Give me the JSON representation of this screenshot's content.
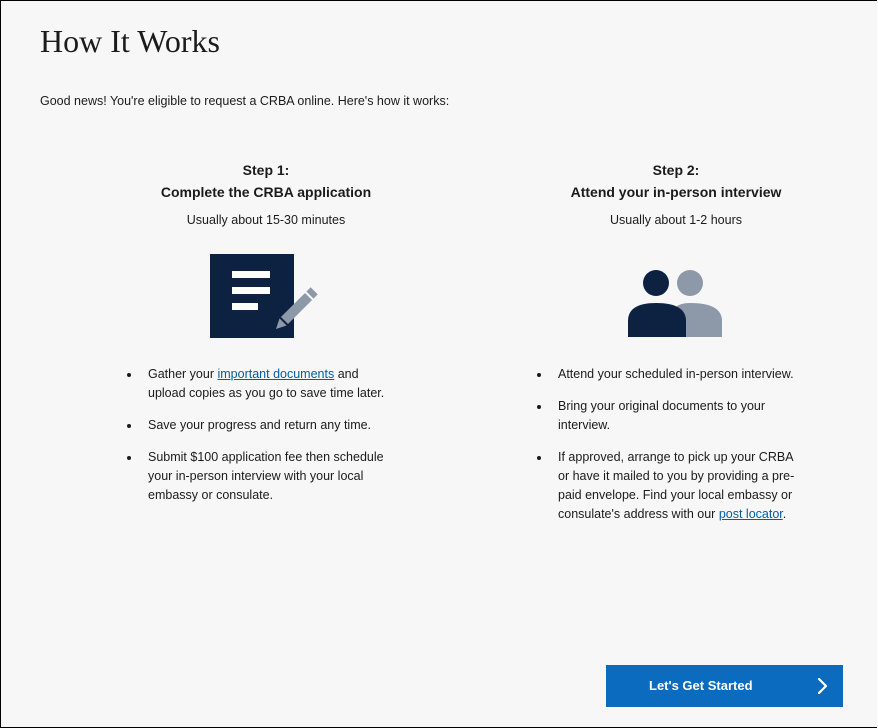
{
  "page": {
    "title": "How It Works",
    "intro": "Good news!  You're eligible to request a CRBA online.  Here's how it works:"
  },
  "step1": {
    "heading_line1": "Step 1:",
    "heading_line2": "Complete the CRBA application",
    "time": "Usually about 15-30 minutes",
    "icon": "document-pencil-icon",
    "bullets": {
      "b1_before": "Gather your ",
      "b1_link": "important documents",
      "b1_after": " and upload copies as you go to save time later.",
      "b2": "Save your progress and return any time.",
      "b3": "Submit $100 application fee then schedule your in-person interview with your local embassy or consulate."
    }
  },
  "step2": {
    "heading_line1": "Step 2:",
    "heading_line2": "Attend your in-person interview",
    "time": "Usually about 1-2 hours",
    "icon": "people-icon",
    "bullets": {
      "b1": "Attend your scheduled in-person interview.",
      "b2": "Bring your original documents to your interview.",
      "b3_before": "If approved, arrange to pick up your CRBA or have it mailed to you by providing a pre-paid envelope. Find your local embassy or consulate's address with our ",
      "b3_link": "post locator",
      "b3_after": "."
    }
  },
  "cta": {
    "label": "Let's Get Started",
    "icon": "chevron-right-icon"
  },
  "colors": {
    "navy": "#0d2240",
    "gray_icon": "#8d99a8",
    "button": "#0b6bbf",
    "link": "#005ea2",
    "background": "#f7f7f7"
  }
}
